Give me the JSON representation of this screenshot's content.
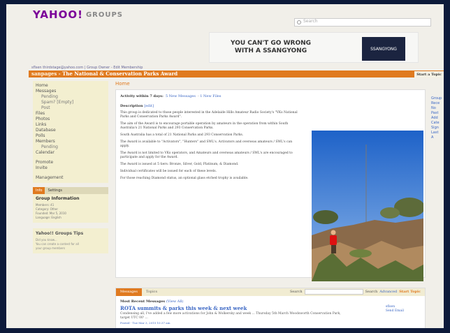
{
  "header": {
    "logo_text": "YAHOO!",
    "groups_text": "GROUPS",
    "search_placeholder": "Search"
  },
  "ad": {
    "headline_line1": "YOU CAN'T GO WRONG",
    "headline_line2": "WITH A SSANGYONG",
    "brand": "SSANGYONG"
  },
  "breadcrumb": "sflsen  thirdstage@yahoo.com  |  Group Owner  -  Edit Membership",
  "titlebar": {
    "group": "sanpages",
    "title": " - The National & Conservation Parks Award",
    "start_topic": "Start a Topic"
  },
  "sidebar": {
    "nav": [
      {
        "label": "Home",
        "sub": false
      },
      {
        "label": "Messages",
        "sub": false
      },
      {
        "label": "Pending",
        "sub": true
      },
      {
        "label": "Spam?   [Empty]",
        "sub": true
      },
      {
        "label": "Post",
        "sub": true
      },
      {
        "label": "Files",
        "sub": false
      },
      {
        "label": "Photos",
        "sub": false
      },
      {
        "label": "Links",
        "sub": false
      },
      {
        "label": "Database",
        "sub": false
      },
      {
        "label": "Polls",
        "sub": false
      },
      {
        "label": "Members",
        "sub": false
      },
      {
        "label": "Pending",
        "sub": true
      },
      {
        "label": "Calendar",
        "sub": false
      }
    ],
    "nav2": [
      {
        "label": "Promote"
      },
      {
        "label": "Invite"
      }
    ],
    "management": "Management",
    "info_tabs": [
      "Info",
      "Settings"
    ],
    "info_title": "Group Information",
    "info_lines": [
      "Members: 41",
      "Category: Other",
      "Founded: Mar 5, 2010",
      "Language: English"
    ],
    "tips_title": "Yahoo!! Groups Tips",
    "tips_lines": [
      "Did you know...",
      "You can create a contest for all",
      "your group members"
    ]
  },
  "main": {
    "home": "Home",
    "activity_label": "Activity within 7 days:",
    "new_messages": "5 New Messages",
    "new_files": "1 New Files",
    "description_label": "Description",
    "description_edit": "[edit]",
    "paragraphs": [
      "This group is dedicated to those people interested in the Adelaide Hills Amateur Radio Society's \"VKs National Parks and Conservation Parks Award\".",
      "The aim of the Award is to encourage portable operation by amateurs in the operation from within South Australia's 21 National Parks and 293 Conservation Parks.",
      "South Australia has a total of 21 National Parks and 293 Conservation Parks.",
      "The Award is available to \"Activators\", \"Hunters\" and SWL's. Activators and overseas amateurs / SWL's can apply.",
      "The Award is not limited to VKs operators, and Amateurs and overseas amateurs / SWL's are encouraged to participate and apply for the Award.",
      "The Award is issued at 5 tiers: Bronze, Silver, Gold, Platinum, & Diamond.",
      "Individual certificates will be issued for each of these levels.",
      "For those reaching Diamond status, an optional glass etched trophy is available."
    ]
  },
  "messages": {
    "tabs": [
      "Messages",
      "Topics"
    ],
    "search_label": "Search",
    "search_button": "Search",
    "advanced": "Advanced",
    "start_topic": "Start Topic",
    "recent_label": "Most Recent Messages",
    "view_all": "(View All)",
    "post_title": "ROTA summits & parks this week & next week",
    "post_body": "Condensing all, I've added a few more activations for John & Wolkersky and week ... Thursday 5th March Woodsworth Conservation Park, target UTC 00' ...",
    "post_meta": "Posted - Tue Mar 3, 2015 10:37 am",
    "post_author": "sflsen",
    "post_author_sub": "Send Email"
  },
  "rightcol": [
    "Group",
    "Rece",
    "No",
    "Past",
    "Add",
    "Cate",
    "Sign",
    "Last",
    "A"
  ]
}
